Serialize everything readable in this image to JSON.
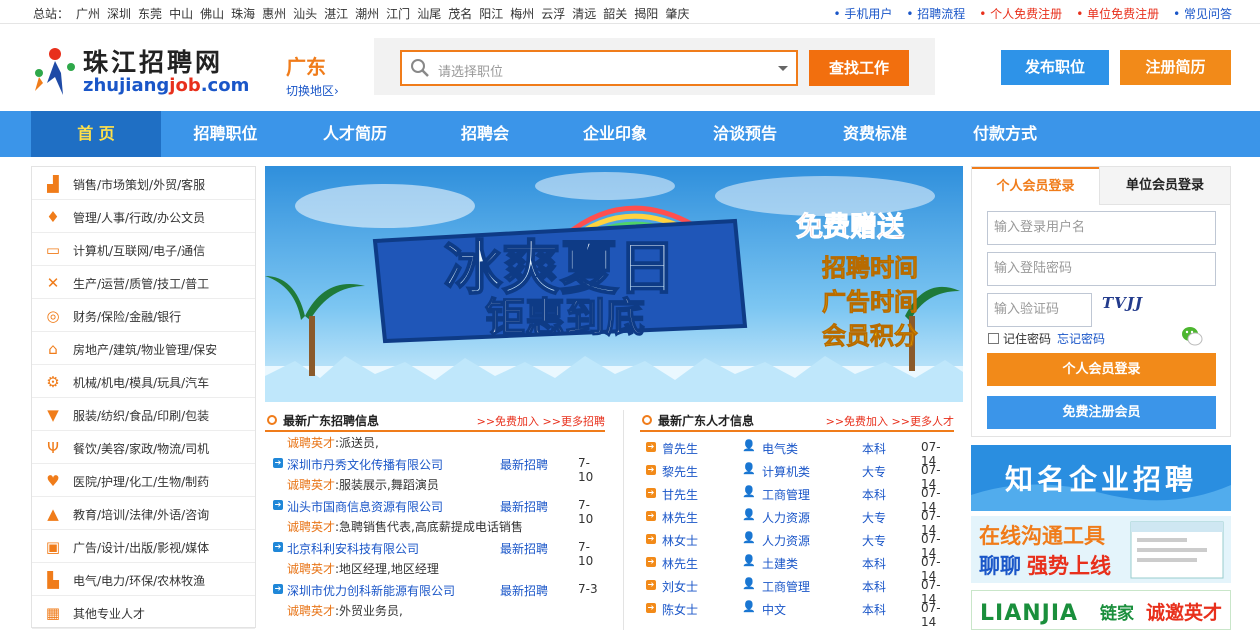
{
  "topbar": {
    "label": "总站：",
    "cities": [
      "广州",
      "深圳",
      "东莞",
      "中山",
      "佛山",
      "珠海",
      "惠州",
      "汕头",
      "湛江",
      "潮州",
      "江门",
      "汕尾",
      "茂名",
      "阳江",
      "梅州",
      "云浮",
      "清远",
      "韶关",
      "揭阳",
      "肇庆"
    ],
    "links": [
      {
        "text": "• 手机用户",
        "c": "l1"
      },
      {
        "text": "• 招聘流程",
        "c": "l1"
      },
      {
        "text": "• 个人免费注册",
        "c": "l2"
      },
      {
        "text": "• 单位免费注册",
        "c": "l2"
      },
      {
        "text": "• 常见问答",
        "c": "l1"
      }
    ]
  },
  "logo": {
    "cn": "珠江招聘网",
    "en_pre": "zhujiang",
    "en_mid": "job",
    "en_post": ".com"
  },
  "region": {
    "name": "广东",
    "switch": "切换地区›"
  },
  "search": {
    "placeholder": "请选择职位",
    "button": "查找工作"
  },
  "header_buttons": {
    "post": "发布职位",
    "resume": "注册简历"
  },
  "nav": [
    {
      "label": "首 页",
      "active": true
    },
    {
      "label": "招聘职位"
    },
    {
      "label": "人才简历"
    },
    {
      "label": "招聘会"
    },
    {
      "label": "企业印象"
    },
    {
      "label": "洽谈预告"
    },
    {
      "label": "资费标准"
    },
    {
      "label": "付款方式"
    }
  ],
  "categories": [
    {
      "label": "销售/市场策划/外贸/客服",
      "icon": "chart-icon",
      "g": "▟"
    },
    {
      "label": "管理/人事/行政/办公文员",
      "icon": "tie-icon",
      "g": "♦"
    },
    {
      "label": "计算机/互联网/电子/通信",
      "icon": "monitor-icon",
      "g": "▭"
    },
    {
      "label": "生产/运营/质管/技工/普工",
      "icon": "tools-icon",
      "g": "✕"
    },
    {
      "label": "财务/保险/金融/银行",
      "icon": "coin-icon",
      "g": "◎"
    },
    {
      "label": "房地产/建筑/物业管理/保安",
      "icon": "house-icon",
      "g": "⌂"
    },
    {
      "label": "机械/机电/模具/玩具/汽车",
      "icon": "gear-icon",
      "g": "⚙"
    },
    {
      "label": "服装/纺织/食品/印刷/包装",
      "icon": "shirt-icon",
      "g": "▼"
    },
    {
      "label": "餐饮/美容/家政/物流/司机",
      "icon": "utensils-icon",
      "g": "Ψ"
    },
    {
      "label": "医院/护理/化工/生物/制药",
      "icon": "heart-icon",
      "g": "♥"
    },
    {
      "label": "教育/培训/法律/外语/咨询",
      "icon": "graduation-icon",
      "g": "▲"
    },
    {
      "label": "广告/设计/出版/影视/媒体",
      "icon": "camera-icon",
      "g": "▣"
    },
    {
      "label": "电气/电力/环保/农林牧渔",
      "icon": "factory-icon",
      "g": "▙"
    },
    {
      "label": "其他专业人才",
      "icon": "grid-icon",
      "g": "▦"
    }
  ],
  "banner": {
    "title1": "冰爽夏日",
    "title2": "钜惠到底",
    "gift": "免费赠送",
    "items": [
      "招聘时间",
      "广告时间",
      "会员积分"
    ]
  },
  "jobs": {
    "title": "最新广东招聘信息",
    "more": ">>免费加入  >>更多招聘",
    "top_invite": {
      "k": "诚聘英才",
      "v": ":派送员,"
    },
    "rows": [
      {
        "company": "深圳市丹秀文化传播有限公司",
        "status": "最新招聘",
        "date": "7-10",
        "k": "诚聘英才",
        "v": ":服装展示,舞蹈演员"
      },
      {
        "company": "汕头市国商信息资源有限公司",
        "status": "最新招聘",
        "date": "7-10",
        "k": "诚聘英才",
        "v": ":急聘销售代表,高底薪提成电话销售"
      },
      {
        "company": "北京科利安科技有限公司",
        "status": "最新招聘",
        "date": "7-10",
        "k": "诚聘英才",
        "v": ":地区经理,地区经理"
      },
      {
        "company": "深圳市优力创科新能源有限公司",
        "status": "最新招聘",
        "date": "7-3",
        "k": "诚聘英才",
        "v": ":外贸业务员,"
      }
    ]
  },
  "talent": {
    "title": "最新广东人才信息",
    "more": ">>免费加入  >>更多人才",
    "rows": [
      {
        "name": "曾先生",
        "major": "电气类",
        "edu": "本科",
        "date": "07-14"
      },
      {
        "name": "黎先生",
        "major": "计算机类",
        "edu": "大专",
        "date": "07-14"
      },
      {
        "name": "甘先生",
        "major": "工商管理",
        "edu": "本科",
        "date": "07-14"
      },
      {
        "name": "林先生",
        "major": "人力资源",
        "edu": "大专",
        "date": "07-14"
      },
      {
        "name": "林女士",
        "major": "人力资源",
        "edu": "大专",
        "date": "07-14"
      },
      {
        "name": "林先生",
        "major": "土建类",
        "edu": "本科",
        "date": "07-14"
      },
      {
        "name": "刘女士",
        "major": "工商管理",
        "edu": "本科",
        "date": "07-14"
      },
      {
        "name": "陈女士",
        "major": "中文",
        "edu": "本科",
        "date": "07-14"
      }
    ]
  },
  "login": {
    "tab_personal": "个人会员登录",
    "tab_company": "单位会员登录",
    "user_ph": "输入登录用户名",
    "pass_ph": "输入登陆密码",
    "code_ph": "输入验证码",
    "captcha": "TVJJ",
    "remember": "记住密码",
    "forgot": "忘记密码",
    "login_btn": "个人会员登录",
    "register_btn": "免费注册会员"
  },
  "ads": {
    "ad1": "知名企业招聘",
    "ad2_l1": "在线沟通工具",
    "ad2_l2a": "聊聊",
    "ad2_l2b": "强势上线",
    "ad3_brand": "LIANJIA",
    "ad3_cn": "链家",
    "ad3_slogan": "诚邀英才"
  }
}
